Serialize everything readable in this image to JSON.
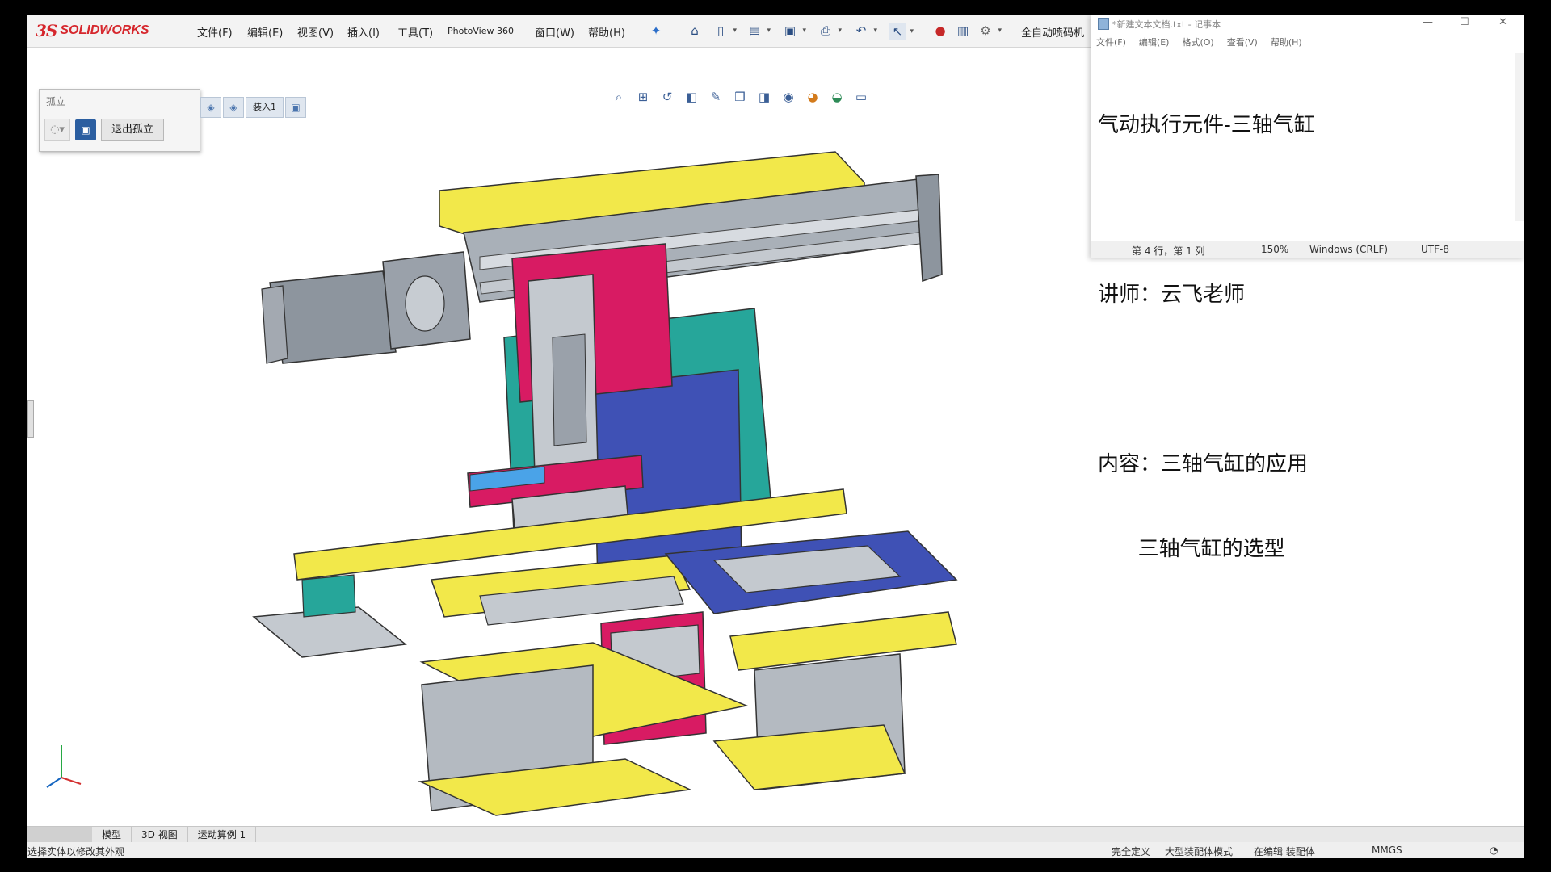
{
  "app": {
    "logo_prefix": "3S",
    "logo_name": "SOLIDWORKS"
  },
  "menu": [
    "文件(F)",
    "编辑(E)",
    "视图(V)",
    "插入(I)",
    "工具(T)",
    "PhotoView 360",
    "窗口(W)",
    "帮助(H)"
  ],
  "command_search": "全自动喷码机",
  "toolbar_icons": [
    "pin-icon",
    "home-icon",
    "new-doc-icon",
    "open-icon",
    "save-icon",
    "print-icon",
    "undo-icon",
    "select-icon",
    "traffic-light-icon",
    "file-properties-icon",
    "options-icon"
  ],
  "heads_up_icons": [
    "zoom-to-fit-icon",
    "zoom-area-icon",
    "previous-view-icon",
    "section-view-icon",
    "dynamic-annotation-icon",
    "view-orientation-icon",
    "display-style-icon",
    "hide-show-icon",
    "edit-appearance-icon",
    "apply-scene-icon",
    "view-settings-icon"
  ],
  "isolate_panel": {
    "title": "孤立",
    "exit_button": "退出孤立"
  },
  "breadcrumb": {
    "label": "装入1"
  },
  "notepad": {
    "title": "*新建文本文档.txt - 记事本",
    "menu": [
      "文件(F)",
      "编辑(E)",
      "格式(O)",
      "查看(V)",
      "帮助(H)"
    ],
    "lines": [
      "气动执行元件-三轴气缸",
      "",
      "讲师：云飞老师",
      "",
      "内容：三轴气缸的应用",
      "      三轴气缸的选型"
    ],
    "status": {
      "position": "第 4 行，第 1 列",
      "zoom": "150%",
      "line_ending": "Windows (CRLF)",
      "encoding": "UTF-8"
    }
  },
  "tabs": [
    "模型",
    "3D 视图",
    "运动算例 1"
  ],
  "status_bar": {
    "hint": "选择实体以修改其外观",
    "definition": "完全定义",
    "mode": "大型装配体模式",
    "editing": "在编辑 装配体",
    "units": "MMGS"
  },
  "colors": {
    "yellow": "#f2e84a",
    "magenta": "#d81b63",
    "teal": "#26a69a",
    "blue": "#3f51b5",
    "grey": "#a9b0b8"
  }
}
